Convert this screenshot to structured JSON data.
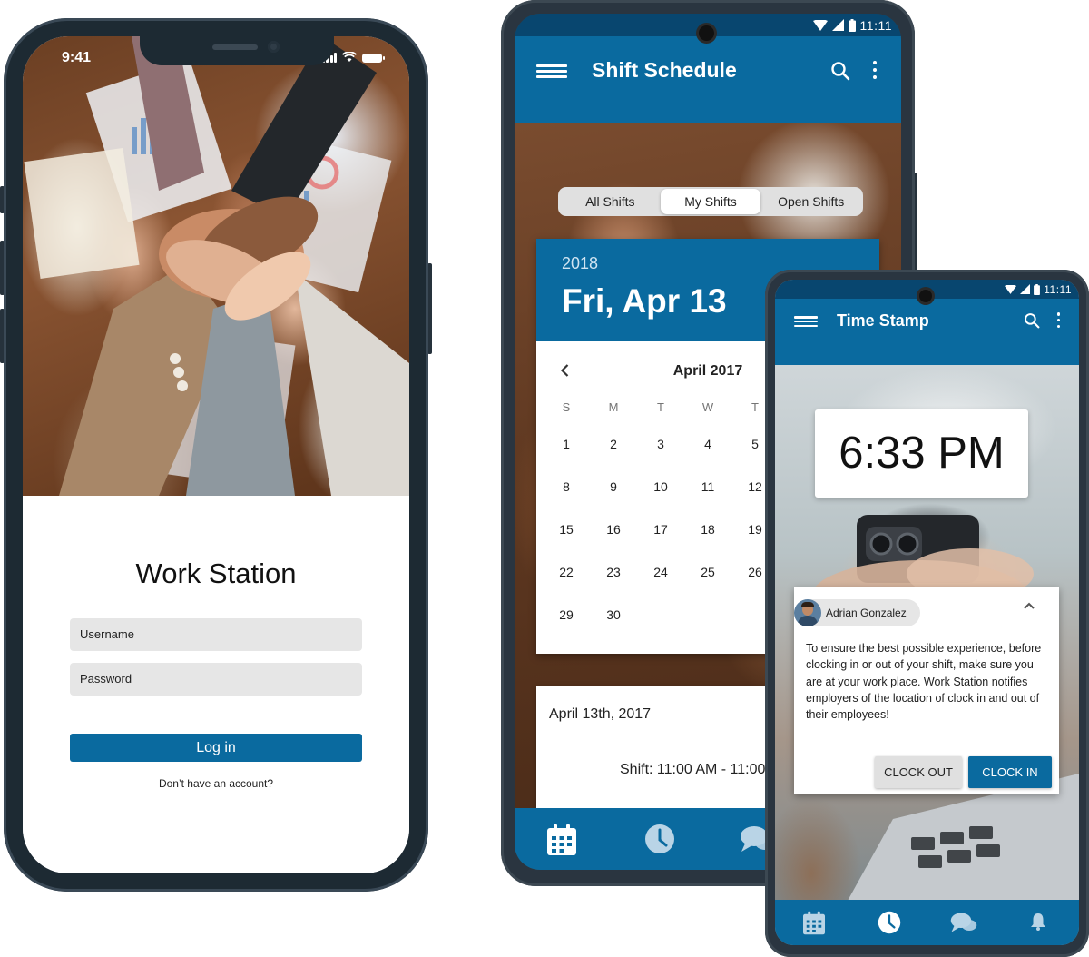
{
  "login_screen": {
    "status_time": "9:41",
    "app_title": "Work Station",
    "username_placeholder": "Username",
    "password_placeholder": "Password",
    "login_button": "Log in",
    "signup_link": "Don’t have an account?"
  },
  "schedule_screen": {
    "status_time": "11:11",
    "title": "Shift Schedule",
    "segments": [
      "All Shifts",
      "My Shifts",
      "Open Shifts"
    ],
    "selected_segment": "My Shifts",
    "selected_year": "2018",
    "selected_date": "Fri, Apr 13",
    "calendar_month": "April 2017",
    "weekdays": [
      "S",
      "M",
      "T",
      "W",
      "T"
    ],
    "days": [
      [
        "1",
        "2",
        "3",
        "4",
        "5"
      ],
      [
        "8",
        "9",
        "10",
        "11",
        "12"
      ],
      [
        "15",
        "16",
        "17",
        "18",
        "19"
      ],
      [
        "22",
        "23",
        "24",
        "25",
        "26"
      ],
      [
        "29",
        "30",
        "",
        "",
        ""
      ]
    ],
    "shift_date": "April 13th, 2017",
    "shift_time": "Shift: 11:00 AM - 11:00",
    "nav_items": [
      "calendar-icon",
      "clock-icon",
      "chat-icon"
    ]
  },
  "timestamp_screen": {
    "status_time": "11:11",
    "title": "Time Stamp",
    "clock": "6:33 PM",
    "user_name": "Adrian Gonzalez",
    "message": "To ensure the best possible experience, before clocking in or out of your shift, make sure you are at your work place. Work Station notifies employers of the location of clock in and out of their employees!",
    "clock_out_button": "CLOCK OUT",
    "clock_in_button": "CLOCK IN",
    "nav_items": [
      "calendar-icon",
      "clock-icon",
      "chat-icon",
      "bell-icon"
    ]
  },
  "colors": {
    "primary": "#0a6a9f",
    "status_bar": "#08466f",
    "frame": "#1d2a33"
  }
}
